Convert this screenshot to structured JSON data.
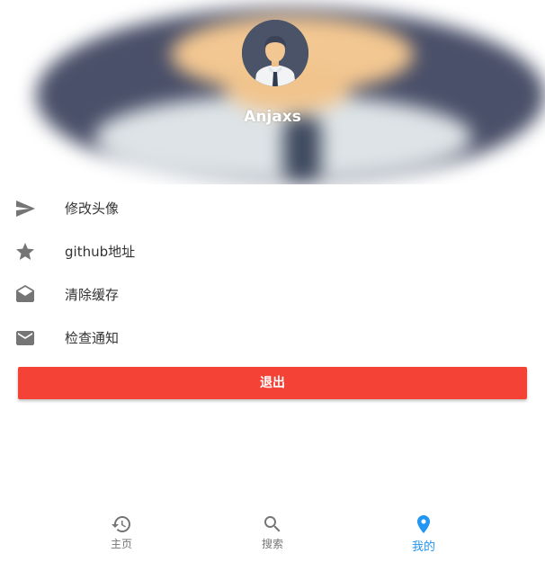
{
  "profile": {
    "username": "Anjaxs"
  },
  "menu": {
    "items": [
      {
        "label": "修改头像",
        "icon": "send-icon"
      },
      {
        "label": "github地址",
        "icon": "star-icon"
      },
      {
        "label": "清除缓存",
        "icon": "drafts-icon"
      },
      {
        "label": "检查通知",
        "icon": "mail-icon"
      }
    ]
  },
  "actions": {
    "logout_label": "退出"
  },
  "bottom_nav": {
    "items": [
      {
        "label": "主页",
        "icon": "history-icon",
        "active": false
      },
      {
        "label": "搜索",
        "icon": "search-icon",
        "active": false
      },
      {
        "label": "我的",
        "icon": "location-pin-icon",
        "active": true
      }
    ]
  },
  "colors": {
    "accent": "#2196f3",
    "danger": "#f44336",
    "icon_grey": "#757575"
  }
}
